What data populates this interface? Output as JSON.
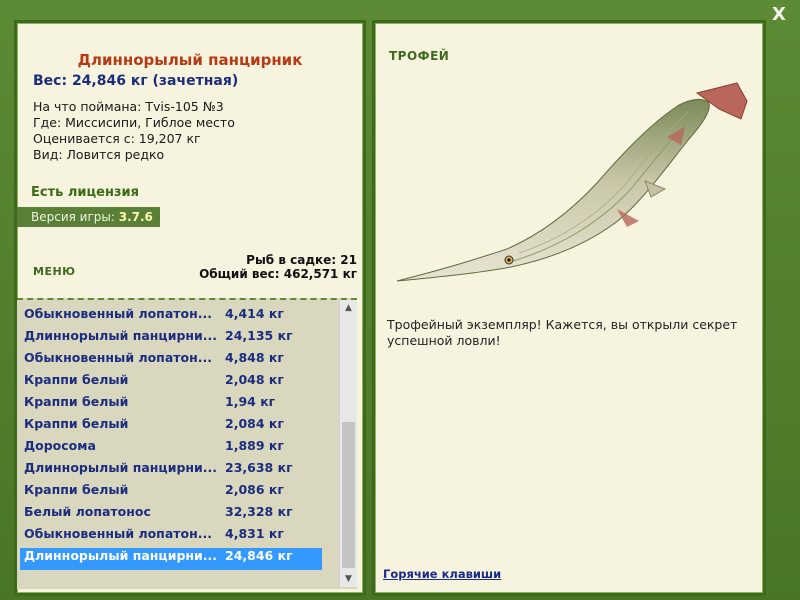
{
  "window": {
    "close_label": "X"
  },
  "fish": {
    "name": "Длиннорылый панцирник",
    "weight": "Вес: 24,846 кг (зачетная)",
    "caught_with": "На что поймана: Tvis-105 №3",
    "location": "Где: Миссисипи, Гиблое место",
    "rated_from": "Оценивается с: 19,207 кг",
    "species_note": "Вид: Ловится редко"
  },
  "license": "Есть лицензия",
  "version": {
    "label": "Версия игры:",
    "value": "3.7.6"
  },
  "menu_label": "МЕНЮ",
  "stats": {
    "fish_in_net": "Рыб в садке: 21",
    "total_weight": "Общий вес: 462,571 кг"
  },
  "catch_list": [
    {
      "name": "Обыкновенный лопатон...",
      "weight": "4,414 кг"
    },
    {
      "name": "Длиннорылый панцирни...",
      "weight": "24,135 кг"
    },
    {
      "name": "Обыкновенный лопатон...",
      "weight": "4,848 кг"
    },
    {
      "name": "Краппи белый",
      "weight": "2,048 кг"
    },
    {
      "name": "Краппи белый",
      "weight": "1,94 кг"
    },
    {
      "name": "Краппи белый",
      "weight": "2,084 кг"
    },
    {
      "name": "Доросома",
      "weight": "1,889 кг"
    },
    {
      "name": "Длиннорылый панцирни...",
      "weight": "23,638 кг"
    },
    {
      "name": "Краппи белый",
      "weight": "2,086 кг"
    },
    {
      "name": "Белый лопатонос",
      "weight": "32,328 кг"
    },
    {
      "name": "Обыкновенный лопатон...",
      "weight": "4,831 кг"
    },
    {
      "name": "Длиннорылый панцирни...",
      "weight": "24,846 кг"
    }
  ],
  "selected_index": 11,
  "trophy_label": "ТРОФЕЙ",
  "trophy_text": "Трофейный экземпляр! Кажется, вы открыли секрет успешной ловли!",
  "hotkeys_label": "Горячие клавиши"
}
